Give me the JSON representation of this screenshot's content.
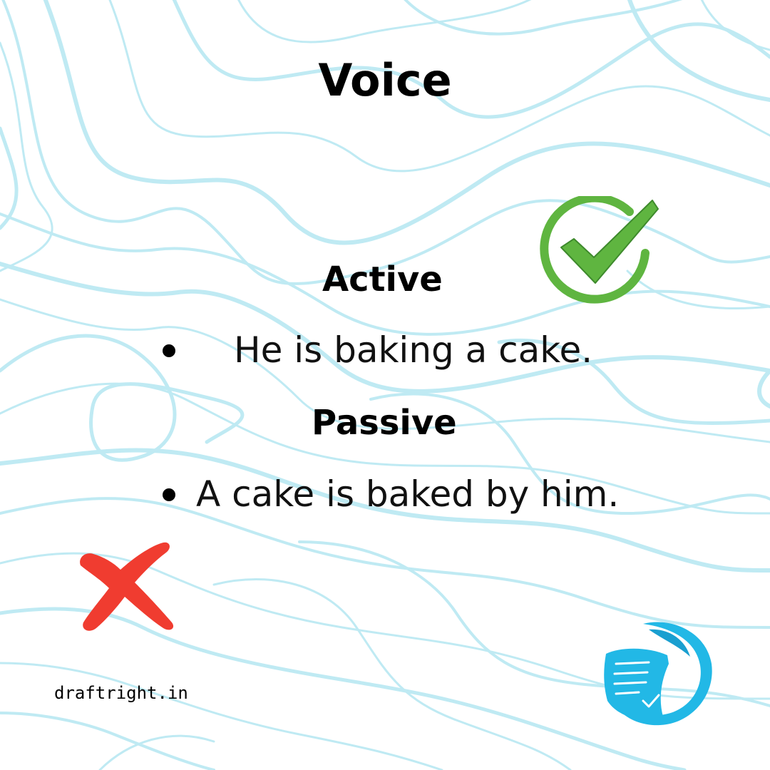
{
  "title": "Voice",
  "sections": [
    {
      "heading": "Active",
      "example": "He is baking a cake."
    },
    {
      "heading": "Passive",
      "example": "A cake is baked by him."
    }
  ],
  "footer": "draftright.in",
  "icons": {
    "correct": "check-circle-icon",
    "incorrect": "cross-icon",
    "logo": "draftright-logo-icon"
  },
  "colors": {
    "background_lines": "#bfeaf3",
    "check": "#5fb540",
    "cross": "#f03c30",
    "logo": "#22b8e6"
  }
}
